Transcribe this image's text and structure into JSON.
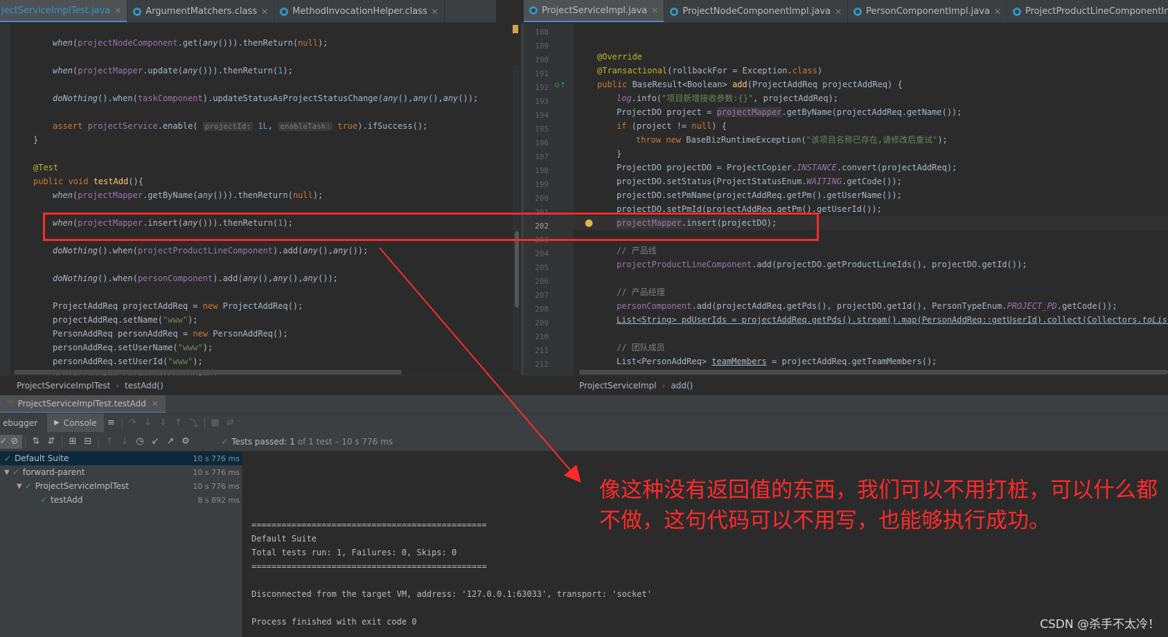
{
  "left_tabs": [
    {
      "label": "jectServiceImplTest.java",
      "active": true
    },
    {
      "label": "ArgumentMatchers.class",
      "active": false
    },
    {
      "label": "MethodInvocationHelper.class",
      "active": false
    }
  ],
  "right_tabs": [
    {
      "label": "ProjectServiceImpl.java",
      "active": true
    },
    {
      "label": "ProjectNodeComponentImpl.java",
      "active": false
    },
    {
      "label": "PersonComponentImpl.java",
      "active": false
    },
    {
      "label": "ProjectProductLineComponentImpl.java",
      "active": false
    }
  ],
  "left_breadcrumb": [
    "ProjectServiceImplTest",
    "testAdd()"
  ],
  "right_breadcrumb": [
    "ProjectServiceImpl",
    "add()"
  ],
  "right_line_numbers": [
    "188",
    "189",
    "190",
    "191",
    "192",
    "193",
    "194",
    "195",
    "196",
    "197",
    "198",
    "199",
    "200",
    "201",
    "202",
    "203",
    "204",
    "205",
    "206",
    "207",
    "208",
    "209",
    "210",
    "211",
    "212"
  ],
  "run": {
    "tab_label": "ProjectServiceImplTest.testAdd",
    "debugger_label": "ebugger",
    "console_label": "Console",
    "status_prefix": "Tests passed: 1",
    "status_suffix": "of 1 test – 10 s 776 ms"
  },
  "tree": [
    {
      "label": "Default Suite",
      "time": "10 s 776 ms",
      "selected": true
    },
    {
      "label": "forward-parent",
      "time": "10 s 776 ms",
      "selected": false
    },
    {
      "label": "ProjectServiceImplTest",
      "time": "10 s 776 ms",
      "selected": false
    },
    {
      "label": "testAdd",
      "time": "8 s 892 ms",
      "selected": false
    }
  ],
  "console": [
    "===============================================",
    "Default Suite",
    "Total tests run: 1, Failures: 0, Skips: 0",
    "===============================================",
    "",
    "Disconnected from the target VM, address: '127.0.0.1:63033', transport: 'socket'",
    "",
    "Process finished with exit code 0"
  ],
  "annotation": "像这种没有返回值的东西，我们可以不用打桩，可以什么都不做，这句代码可以不用写，也能够执行成功。",
  "watermark": "CSDN @杀手不太冷！",
  "accent": "#4a88c7",
  "highlight_color": "#ff2b2b"
}
